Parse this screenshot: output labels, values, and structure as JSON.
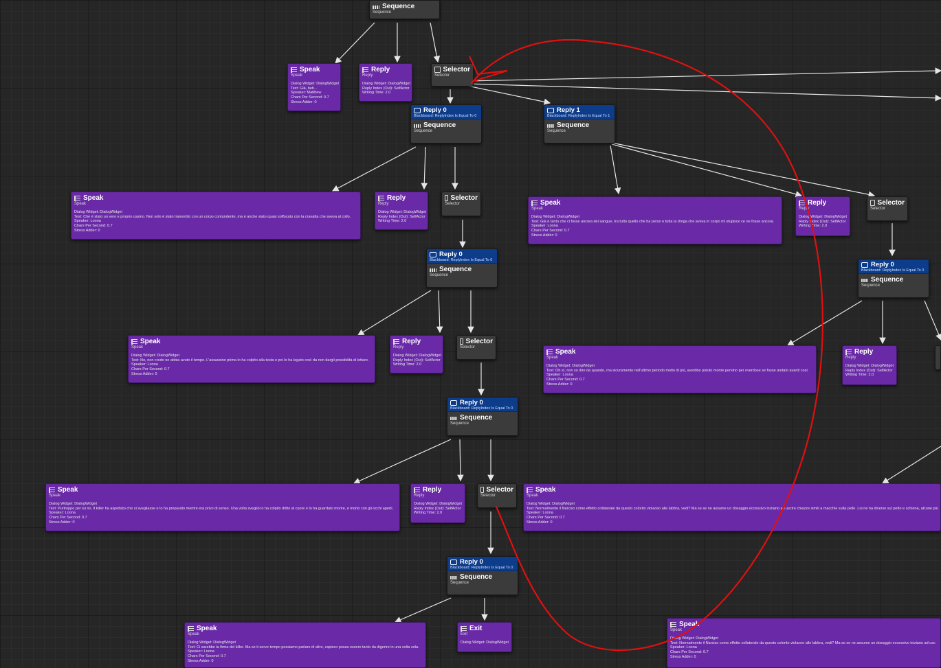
{
  "colors": {
    "task": "#6a2aa8",
    "composite": "#3b3b3b",
    "decorator": "#0d3c8a",
    "wire": "#e6e6e6",
    "annotation": "#e01010"
  },
  "nodes": {
    "root": {
      "title": "Sequence",
      "subtitle": "Sequence"
    },
    "speak_matthew": {
      "title": "Speak",
      "subtitle": "Speak",
      "lines": [
        "Dialog Widget: DialogWidget",
        "Text: Già, beh...",
        "Speaker: Matthew",
        "Chars Per Second: 0.7",
        "Stress Adder: 0"
      ]
    },
    "reply_a": {
      "title": "Reply",
      "subtitle": "Reply",
      "lines": [
        "Dialog Widget: DialogWidget",
        "Reply Index (Out): SelfActor",
        "Writing Time: 2.0"
      ]
    },
    "selector_a": {
      "title": "Selector",
      "subtitle": "Selector"
    },
    "seq_r0_a": {
      "deco_title": "Reply 0",
      "deco_text": "Blackboard: ReplyIndex Is Equal To 0",
      "title": "Sequence",
      "subtitle": "Sequence"
    },
    "seq_r1_a": {
      "deco_title": "Reply 1",
      "deco_text": "Blackboard: ReplyIndex Is Equal To 1",
      "title": "Sequence",
      "subtitle": "Sequence"
    },
    "speak_b1": {
      "title": "Speak",
      "subtitle": "Speak",
      "lines": [
        "Dialog Widget: DialogWidget",
        "Text: Che è stato un vero e proprio casino. Non solo è stato tramortito con un corpo contundente, ma è anche stato quasi soffocato con la cravatta che aveva al collo.",
        "Speaker: Loona",
        "Chars Per Second: 0.7",
        "Stress Adder: 0"
      ]
    },
    "reply_b1": {
      "title": "Reply",
      "subtitle": "Reply",
      "lines": [
        "Dialog Widget: DialogWidget",
        "Reply Index (Out): SelfActor",
        "Writing Time: 2.0"
      ]
    },
    "selector_b1": {
      "title": "Selector",
      "subtitle": "Selector"
    },
    "speak_b2": {
      "title": "Speak",
      "subtitle": "Speak",
      "lines": [
        "Dialog Widget: DialogWidget",
        "Text: Già è tanto che ci fosse ancora del sangue, tra tutto quello che ha perso e tutta la droga che aveva in corpo mi stupisce ce ne fosse ancora.",
        "Speaker: Loona",
        "Chars Per Second: 0.7",
        "Stress Adder: 0"
      ]
    },
    "reply_b2": {
      "title": "Reply",
      "subtitle": "Reply",
      "lines": [
        "Dialog Widget: DialogWidget",
        "Reply Index (Out): SelfActor",
        "Writing Time: 2.0"
      ]
    },
    "selector_b2": {
      "title": "Selector",
      "subtitle": "Selector"
    },
    "seq_r0_c1": {
      "deco_title": "Reply 0",
      "deco_text": "Blackboard: ReplyIndex Is Equal To 0",
      "title": "Sequence",
      "subtitle": "Sequence"
    },
    "seq_r0_c2": {
      "deco_title": "Reply 0",
      "deco_text": "Blackboard: ReplyIndex Is Equal To 0",
      "title": "Sequence",
      "subtitle": "Sequence"
    },
    "speak_d1": {
      "title": "Speak",
      "subtitle": "Speak",
      "lines": [
        "Dialog Widget: DialogWidget",
        "Text: No, non credo ne abbia avuto il tempo. L'assassino prima lo ha colpito alla testa e poi lo ha legato così da non dargli possibilità di lottare.",
        "Speaker: Loona",
        "Chars Per Second: 0.7",
        "Stress Adder: 0"
      ]
    },
    "reply_d1": {
      "title": "Reply",
      "subtitle": "Reply",
      "lines": [
        "Dialog Widget: DialogWidget",
        "Reply Index (Out): SelfActor",
        "Writing Time: 2.0"
      ]
    },
    "selector_d1": {
      "title": "Selector",
      "subtitle": "Selector"
    },
    "speak_d2": {
      "title": "Speak",
      "subtitle": "Speak",
      "lines": [
        "Dialog Widget: DialogWidget",
        "Text: Oh sì, non so dire da quando, ma sicuramente nell'ultimo periodo molto di più, avrebbe potuto morire persino per overdose se fosse andato avanti così.",
        "Speaker: Loona",
        "Chars Per Second: 0.7",
        "Stress Adder: 0"
      ]
    },
    "reply_d2": {
      "title": "Reply",
      "subtitle": "Reply",
      "lines": [
        "Dialog Widget: DialogWidget",
        "Reply Index (Out): SelfActor",
        "Writing Time: 2.0"
      ]
    },
    "seq_r0_e": {
      "deco_title": "Reply 0",
      "deco_text": "Blackboard: ReplyIndex Is Equal To 0",
      "title": "Sequence",
      "subtitle": "Sequence"
    },
    "speak_f1": {
      "title": "Speak",
      "subtitle": "Speak",
      "lines": [
        "Dialog Widget: DialogWidget",
        "Text: Purtroppo per lui no. Il killer ha aspettato che si svegliasse e lo ha preparato mentre era privo di senso. Una volta sveglio lo ha colpito dritto al cuore e lo ha guardato morire, e morto con gli occhi aperti.",
        "Speaker: Loona",
        "Chars Per Second: 0.7",
        "Stress Adder: 0"
      ]
    },
    "reply_f1": {
      "title": "Reply",
      "subtitle": "Reply",
      "lines": [
        "Dialog Widget: DialogWidget",
        "Reply Index (Out): SelfActor",
        "Writing Time: 2.0"
      ]
    },
    "selector_f1": {
      "title": "Selector",
      "subtitle": "Selector"
    },
    "speak_f2": {
      "title": "Speak",
      "subtitle": "Speak",
      "lines": [
        "Dialog Widget: DialogWidget",
        "Text: Normalmente il Narciso come effetto collaterale da questo colorito violaceo alle labbra, vedi? Ma se se ne assume un dosaggio eccessivo iniziano ad uscire chiazze simili a macchie sulla pelle. Lui ne ha diverse sul petto e schiena, alcune più",
        "Speaker: Loona",
        "Chars Per Second: 0.7",
        "Stress Adder: 0"
      ]
    },
    "seq_r0_g": {
      "deco_title": "Reply 0",
      "deco_text": "Blackboard: ReplyIndex Is Equal To 0",
      "title": "Sequence",
      "subtitle": "Sequence"
    },
    "speak_h1": {
      "title": "Speak",
      "subtitle": "Speak",
      "lines": [
        "Dialog Widget: DialogWidget",
        "Text: Ci sarebbe la firma del killer. Ma se ti serve tempo possiamo parlare di altro, capisco possa essere tanto da digerire in una volta sola.",
        "Speaker: Loona",
        "Chars Per Second: 0.7",
        "Stress Adder: 0"
      ]
    },
    "exit_h": {
      "title": "Exit",
      "subtitle": "Exit",
      "lines": [
        "Dialog Widget: DialogWidget"
      ]
    },
    "speak_h2": {
      "title": "Speak",
      "subtitle": "Speak",
      "lines": [
        "Dialog Widget: DialogWidget",
        "Text: Normalmente il Narciso come effetto collaterale da questo colorito violaceo alle labbra, vedi? Ma se se ne assume un dosaggio eccessivo iniziano ad usc",
        "Speaker: Loona",
        "Chars Per Second: 0.7",
        "Stress Adder: 0"
      ]
    }
  }
}
